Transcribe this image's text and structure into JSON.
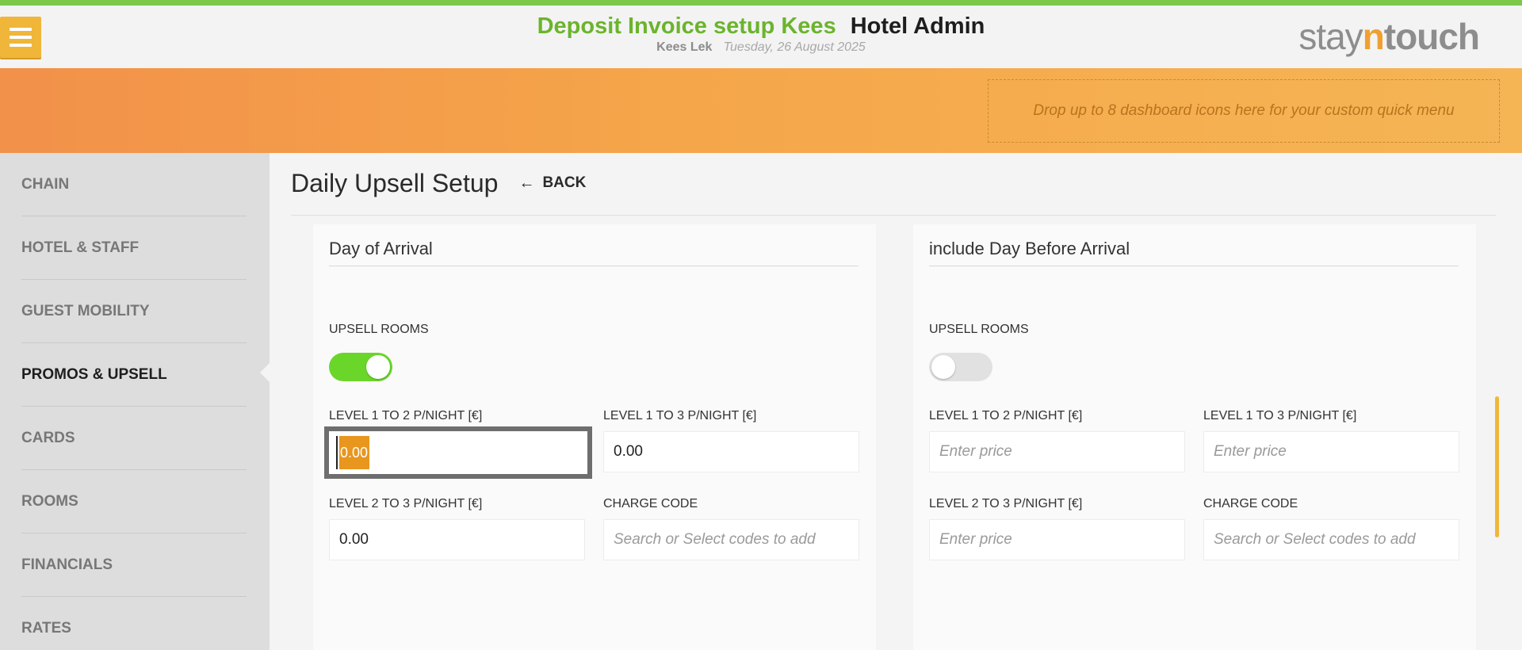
{
  "header": {
    "title_green": "Deposit Invoice setup Kees",
    "title_dark": "Hotel Admin",
    "user": "Kees Lek",
    "date": "Tuesday, 26 August 2025",
    "logo_stay": "stay",
    "logo_n": "n",
    "logo_touch": "touch",
    "menu_icon": "hamburger-menu-icon"
  },
  "banner": {
    "dropzone_text": "Drop up to 8 dashboard icons here for your custom quick menu"
  },
  "sidebar": {
    "items": [
      {
        "label": "CHAIN",
        "active": false
      },
      {
        "label": "HOTEL & STAFF",
        "active": false
      },
      {
        "label": "GUEST MOBILITY",
        "active": false
      },
      {
        "label": "PROMOS & UPSELL",
        "active": true
      },
      {
        "label": "CARDS",
        "active": false
      },
      {
        "label": "ROOMS",
        "active": false
      },
      {
        "label": "FINANCIALS",
        "active": false
      },
      {
        "label": "RATES",
        "active": false
      }
    ]
  },
  "page": {
    "title": "Daily Upsell Setup",
    "back_label": "BACK",
    "back_icon": "left-arrow-icon"
  },
  "arrival": {
    "title": "Day of Arrival",
    "upsell_label": "UPSELL ROOMS",
    "upsell_on": true,
    "l12_label": "LEVEL 1 TO 2 P/NIGHT [€]",
    "l12_value": "0.00",
    "l13_label": "LEVEL 1 TO 3 P/NIGHT [€]",
    "l13_value": "0.00",
    "l23_label": "LEVEL 2 TO 3 P/NIGHT [€]",
    "l23_value": "0.00",
    "charge_label": "CHARGE CODE",
    "charge_placeholder": "Search or Select codes to add"
  },
  "before": {
    "title": "include Day Before Arrival",
    "upsell_label": "UPSELL ROOMS",
    "upsell_on": false,
    "l12_label": "LEVEL 1 TO 2 P/NIGHT [€]",
    "l12_placeholder": "Enter price",
    "l13_label": "LEVEL 1 TO 3 P/NIGHT [€]",
    "l13_placeholder": "Enter price",
    "l23_label": "LEVEL 2 TO 3 P/NIGHT [€]",
    "l23_placeholder": "Enter price",
    "charge_label": "CHARGE CODE",
    "charge_placeholder": "Search or Select codes to add"
  },
  "colors": {
    "accent_green": "#6bb42c",
    "accent_orange": "#f0a030",
    "toggle_on": "#6bd62a"
  }
}
